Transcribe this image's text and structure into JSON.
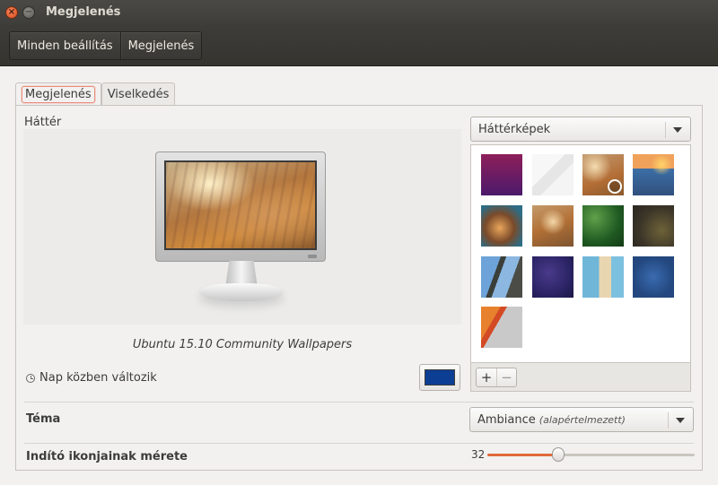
{
  "window": {
    "title": "Megjelenés"
  },
  "breadcrumb": {
    "items": [
      "Minden beállítás",
      "Megjelenés"
    ]
  },
  "tabs": [
    {
      "label": "Megjelenés",
      "active": true
    },
    {
      "label": "Viselkedés",
      "active": false
    }
  ],
  "background": {
    "label": "Háttér",
    "source_selected": "Háttérképek",
    "caption": "Ubuntu 15.10 Community Wallpapers",
    "change_during_day": "Nap közben változik",
    "color": "#0c3e94",
    "add_symbol": "+",
    "remove_symbol": "−",
    "wallpapers": [
      {
        "name": "purple-gradient",
        "selected": false
      },
      {
        "name": "white-geometric",
        "selected": false
      },
      {
        "name": "dry-grass-flowers",
        "selected": true
      },
      {
        "name": "stacked-stones-sunset",
        "selected": false
      },
      {
        "name": "dandelion-closeup",
        "selected": false
      },
      {
        "name": "dry-grass-flowers-alt",
        "selected": false
      },
      {
        "name": "green-clover",
        "selected": false
      },
      {
        "name": "dark-leaves",
        "selected": false
      },
      {
        "name": "palm-trees-sky",
        "selected": false
      },
      {
        "name": "blue-purple-texture",
        "selected": false
      },
      {
        "name": "building-facade-sky",
        "selected": false
      },
      {
        "name": "blue-water-texture",
        "selected": false
      },
      {
        "name": "orange-grey-stripes",
        "selected": false
      }
    ]
  },
  "theme": {
    "label": "Téma",
    "value": "Ambiance",
    "value_hint": "(alapértelmezett)"
  },
  "launcher": {
    "label": "Indító ikonjainak mérete",
    "icon_size": 32,
    "slider_fraction": 0.34
  }
}
